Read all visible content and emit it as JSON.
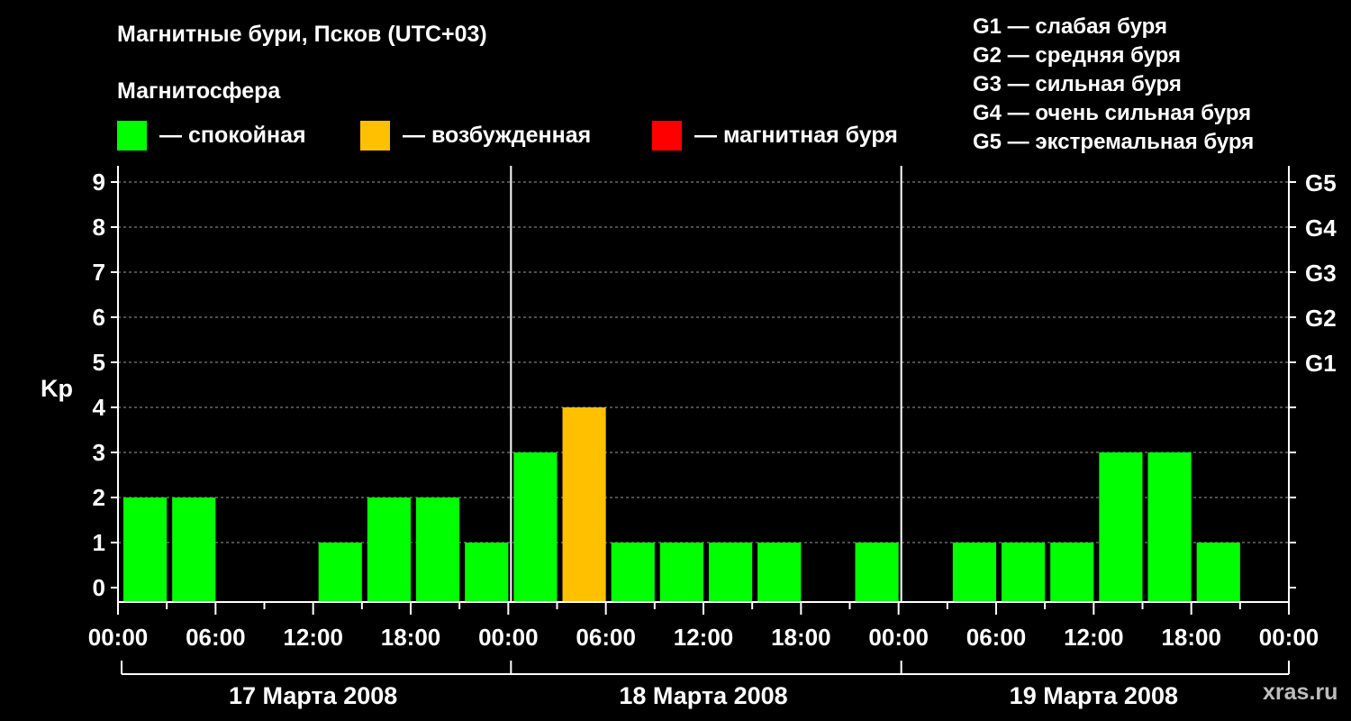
{
  "title": "Магнитные бури, Псков (UTC+03)",
  "subtitle": "Магнитосфера",
  "legend": [
    {
      "label": "— спокойная",
      "color": "#00ff00"
    },
    {
      "label": "— возбужденная",
      "color": "#ffc000"
    },
    {
      "label": "— магнитная буря",
      "color": "#ff0000"
    }
  ],
  "g_legend": [
    "G1 — слабая буря",
    "G2 — средняя буря",
    "G3 — сильная буря",
    "G4 — очень сильная буря",
    "G5 — экстремальная буря"
  ],
  "watermark": "xras.ru",
  "chart_data": {
    "type": "bar",
    "title": "Магнитные бури, Псков (UTC+03)",
    "ylabel": "Kp",
    "ylim": [
      0,
      9
    ],
    "y_ticks": [
      "0",
      "1",
      "2",
      "3",
      "4",
      "5",
      "6",
      "7",
      "8",
      "9"
    ],
    "right_ticks": [
      {
        "value": 5,
        "label": "G1"
      },
      {
        "value": 6,
        "label": "G2"
      },
      {
        "value": 7,
        "label": "G3"
      },
      {
        "value": 8,
        "label": "G4"
      },
      {
        "value": 9,
        "label": "G5"
      }
    ],
    "x_tick_labels": [
      "00:00",
      "06:00",
      "12:00",
      "18:00",
      "00:00",
      "06:00",
      "12:00",
      "18:00",
      "00:00",
      "06:00",
      "12:00",
      "18:00",
      "00:00"
    ],
    "days": [
      "17 Марта 2008",
      "18 Марта 2008",
      "19 Марта 2008"
    ],
    "grid": true,
    "values": [
      2,
      2,
      0,
      0,
      1,
      2,
      2,
      1,
      3,
      4,
      1,
      1,
      1,
      1,
      0,
      1,
      0,
      1,
      1,
      1,
      3,
      3,
      1
    ],
    "colors": [
      "#00ff00",
      "#00ff00",
      "#00ff00",
      "#00ff00",
      "#00ff00",
      "#00ff00",
      "#00ff00",
      "#00ff00",
      "#00ff00",
      "#ffc000",
      "#00ff00",
      "#00ff00",
      "#00ff00",
      "#00ff00",
      "#00ff00",
      "#00ff00",
      "#00ff00",
      "#00ff00",
      "#00ff00",
      "#00ff00",
      "#00ff00",
      "#00ff00",
      "#00ff00",
      "#00ff00"
    ],
    "slots_per_day": 8,
    "hours_per_slot": 3
  }
}
